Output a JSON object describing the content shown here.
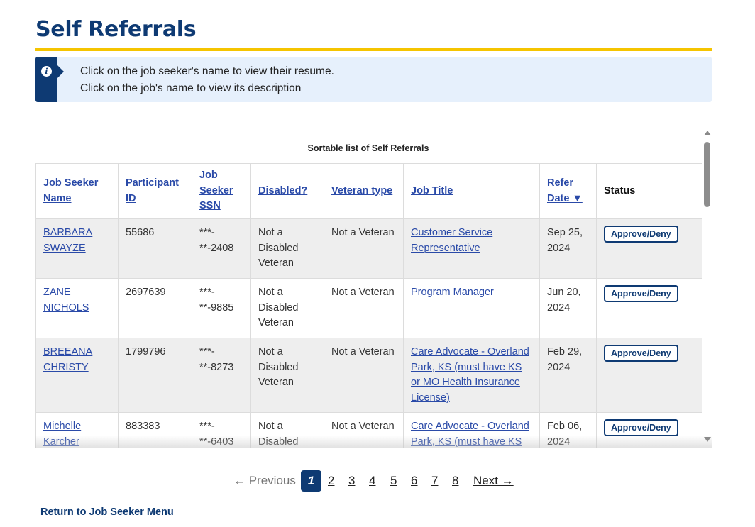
{
  "page": {
    "title": "Self Referrals"
  },
  "alert": {
    "icon": "info-icon",
    "line1": "Click on the job seeker's name to view their resume.",
    "line2": "Click on the job's name to view its description"
  },
  "table": {
    "caption": "Sortable list of Self Referrals",
    "headers": {
      "name": "Job Seeker Name",
      "participant_id": "Participant ID",
      "ssn": "Job Seeker SSN",
      "disabled": "Disabled?",
      "veteran": "Veteran type",
      "job_title": "Job Title",
      "refer_date": "Refer Date ▼",
      "status": "Status"
    },
    "rows": [
      {
        "name": "BARBARA SWAYZE",
        "participant_id": "55686",
        "ssn": "***-**-2408",
        "disabled": "Not a Disabled Veteran",
        "veteran": "Not a Veteran",
        "job_title": "Customer Service Representative",
        "refer_date": "Sep 25, 2024",
        "action": "Approve/Deny"
      },
      {
        "name": "ZANE NICHOLS",
        "participant_id": "2697639",
        "ssn": "***-**-9885",
        "disabled": "Not a Disabled Veteran",
        "veteran": "Not a Veteran",
        "job_title": "Program Manager",
        "refer_date": "Jun 20, 2024",
        "action": "Approve/Deny"
      },
      {
        "name": "BREEANA CHRISTY",
        "participant_id": "1799796",
        "ssn": "***-**-8273",
        "disabled": "Not a Disabled Veteran",
        "veteran": "Not a Veteran",
        "job_title": "Care Advocate - Overland Park, KS (must have KS or MO Health Insurance License)",
        "refer_date": "Feb 29, 2024",
        "action": "Approve/Deny"
      },
      {
        "name": "Michelle Karcher",
        "participant_id": "883383",
        "ssn": "***-**-6403",
        "disabled": "Not a Disabled Veteran",
        "veteran": "Not a Veteran",
        "job_title": "Care Advocate - Overland Park, KS (must have KS or MO Health Insurance License)",
        "refer_date": "Feb 06, 2024",
        "action": "Approve/Deny"
      }
    ]
  },
  "pagination": {
    "previous": "← Previous",
    "pages": [
      "1",
      "2",
      "3",
      "4",
      "5",
      "6",
      "7",
      "8"
    ],
    "current": "1",
    "next": "Next →"
  },
  "footer": {
    "return_link": "Return to Job Seeker Menu"
  },
  "colors": {
    "brand_navy": "#0e3a73",
    "accent_yellow": "#f5c400",
    "alert_bg": "#e6f0fc",
    "link_blue": "#2a4aa8"
  }
}
